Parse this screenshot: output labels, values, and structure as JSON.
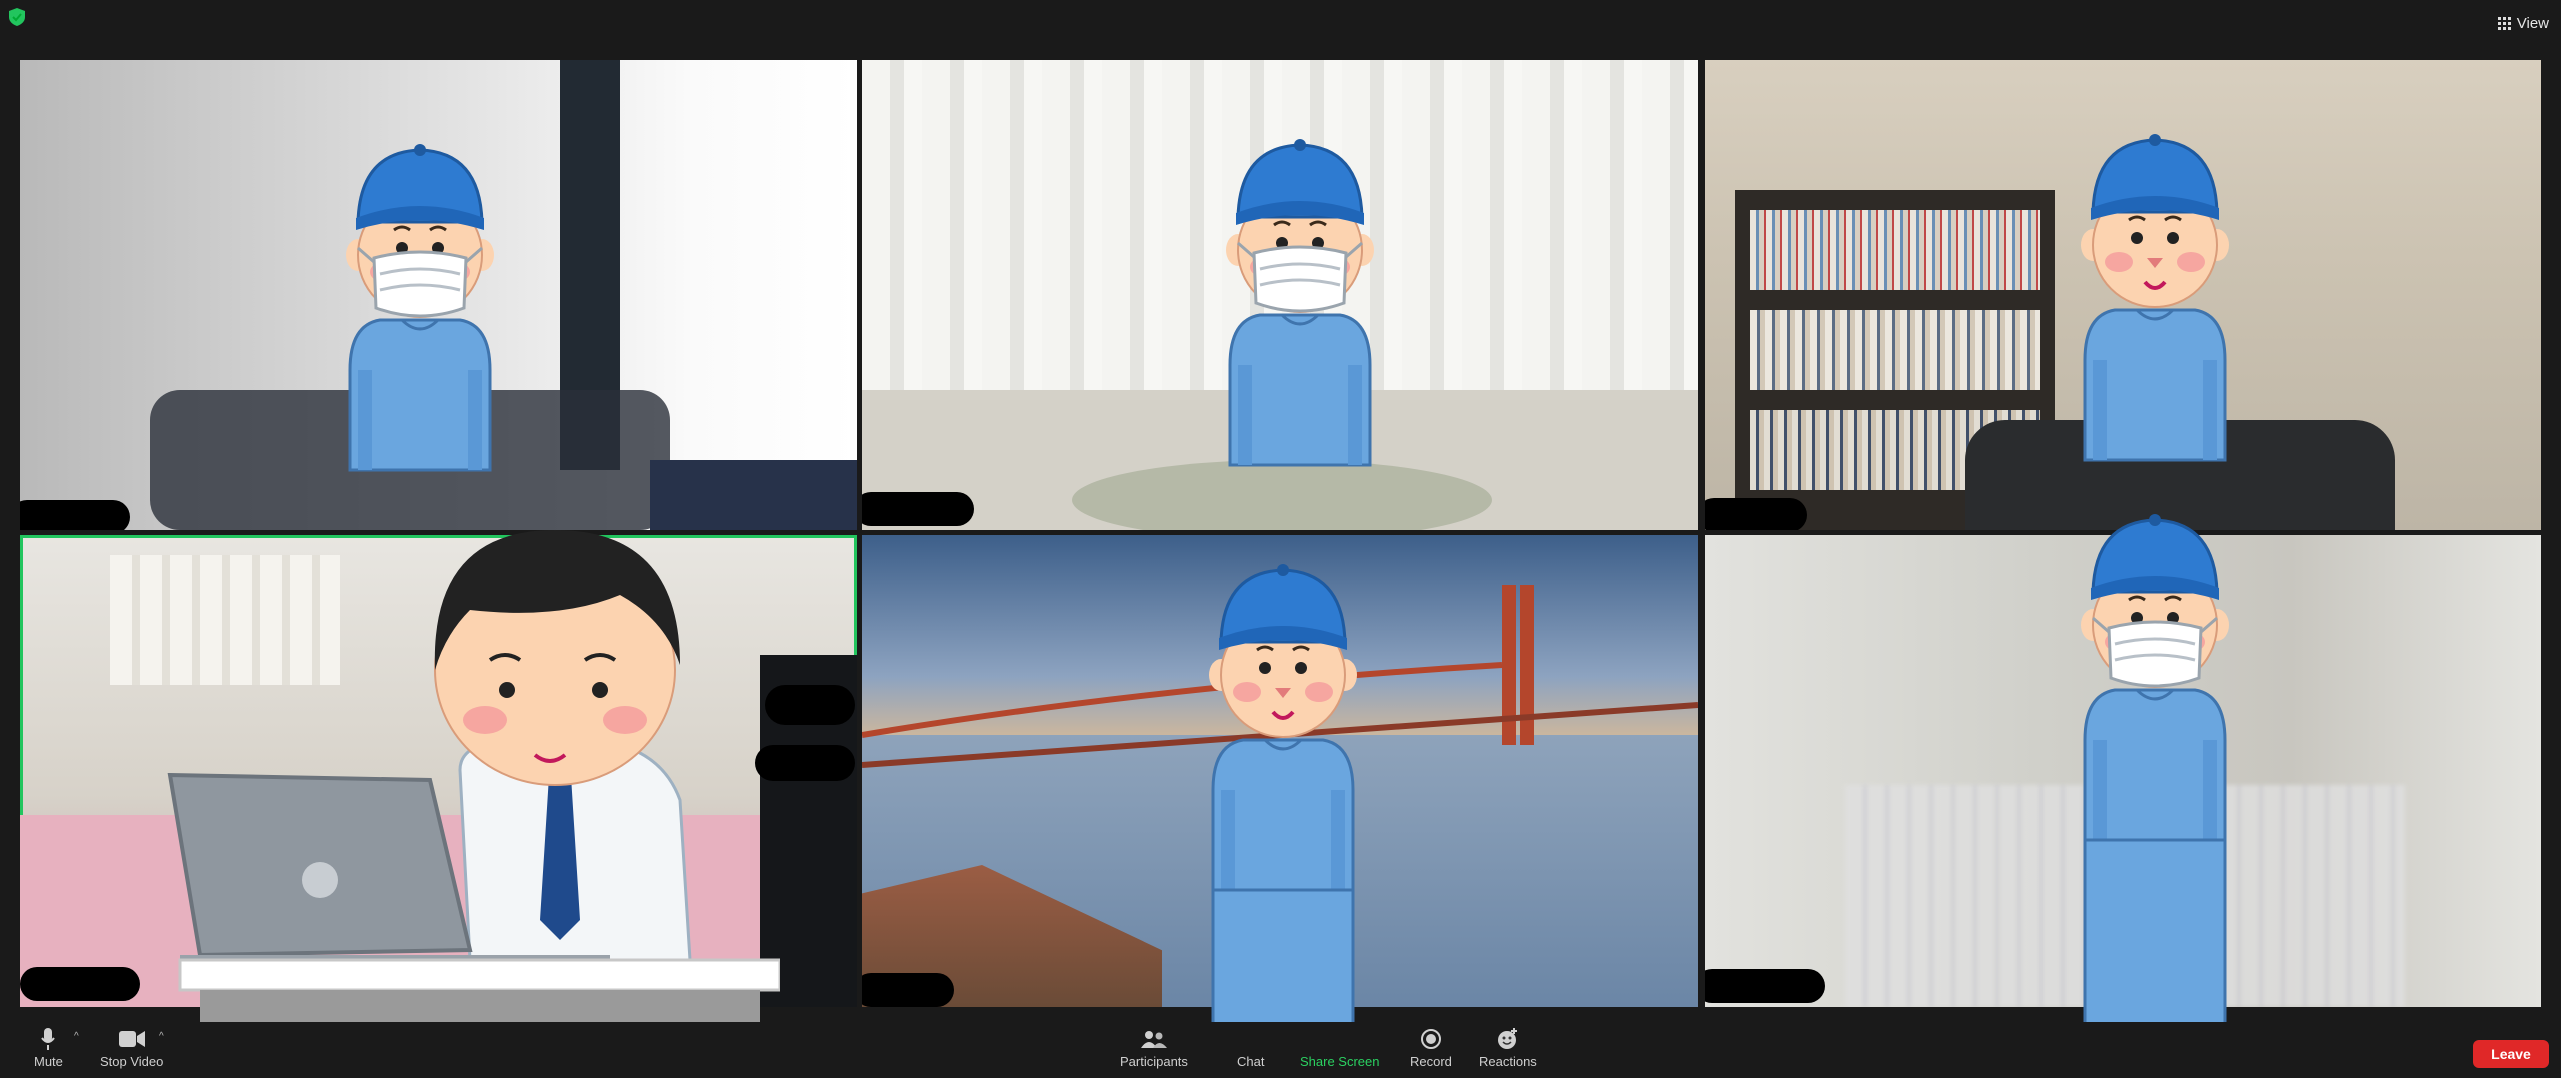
{
  "top_bar": {
    "view_label": "View",
    "icons": [
      "shield-icon",
      "grid-icon"
    ]
  },
  "participants": [
    {
      "tile": 1,
      "scene": "room-with-curtain",
      "name": "",
      "avatar": "boy-cap-mask"
    },
    {
      "tile": 2,
      "scene": "white-curtain-window",
      "name": "",
      "avatar": "boy-cap-mask"
    },
    {
      "tile": 3,
      "scene": "bookshelf",
      "name": "",
      "avatar": "boy-cap-smile"
    },
    {
      "tile": 4,
      "scene": "bedroom",
      "name": "",
      "avatar": "man-labcoat-laptop",
      "active_speaker": true
    },
    {
      "tile": 5,
      "scene": "golden-gate-bridge-virtual-background",
      "name": "",
      "avatar": "boy-cap-smile"
    },
    {
      "tile": 6,
      "scene": "blurred-room",
      "name": "",
      "avatar": "boy-cap-mask"
    }
  ],
  "controls": {
    "mute": "Mute",
    "stop_video": "Stop Video",
    "participants": "Participants",
    "chat": "Chat",
    "share_screen": "Share Screen",
    "record": "Record",
    "reactions": "Reactions",
    "leave": "Leave"
  },
  "colors": {
    "active_border": "#22c55e",
    "share_screen": "#2bd161",
    "leave_button": "#e02828",
    "background": "#1a1a1a"
  }
}
